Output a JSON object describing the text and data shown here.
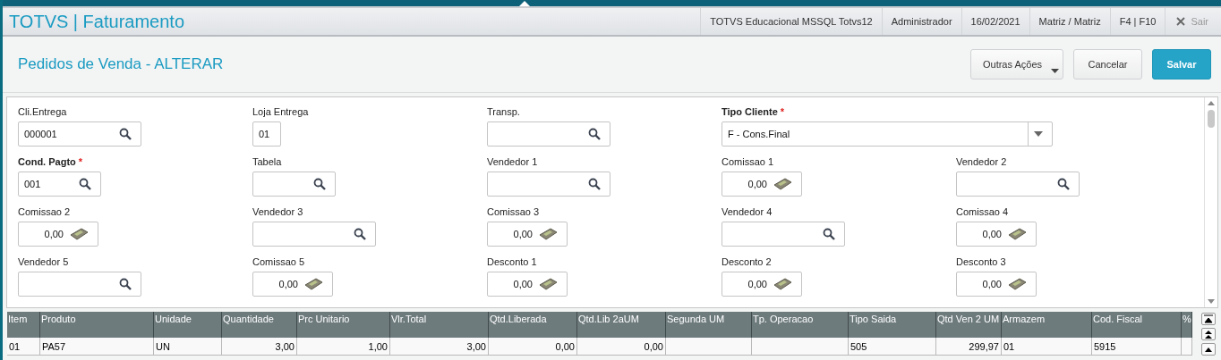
{
  "app_header": {
    "title": "TOTVS | Faturamento",
    "status_items": [
      "TOTVS Educacional MSSQL Totvs12",
      "Administrador",
      "16/02/2021",
      "Matriz / Matriz",
      "F4 | F10"
    ],
    "exit": {
      "label": "Sair",
      "disabled": true
    }
  },
  "page": {
    "title": "Pedidos de Venda - ALTERAR",
    "buttons": [
      {
        "label": "Outras Ações",
        "kind": "menu"
      },
      {
        "label": "Cancelar",
        "kind": "secondary"
      },
      {
        "label": "Salvar",
        "kind": "primary"
      }
    ]
  },
  "form": {
    "fields": [
      {
        "label": "Cli.Entrega",
        "kind": "lookup",
        "value": "000001"
      },
      {
        "label": "Loja Entrega",
        "kind": "plain",
        "value": "01"
      },
      {
        "label": "Transp.",
        "kind": "lookup"
      },
      {
        "label": "Tipo Cliente",
        "kind": "select",
        "value": "F - Cons.Final",
        "required_mark": "*"
      },
      {
        "label": "Cond. Pagto",
        "kind": "lookup_short",
        "value": "001",
        "required_mark": "*"
      },
      {
        "label": "Tabela",
        "kind": "lookup_short"
      },
      {
        "label": "Vendedor 1",
        "kind": "lookup"
      },
      {
        "label": "Comissao 1",
        "kind": "money",
        "value": "0,00"
      },
      {
        "label": "Vendedor 2",
        "kind": "lookup"
      },
      {
        "label": "Comissao 2",
        "kind": "money",
        "value": "0,00"
      },
      {
        "label": "Vendedor 3",
        "kind": "lookup"
      },
      {
        "label": "Comissao 3",
        "kind": "money",
        "value": "0,00"
      },
      {
        "label": "Vendedor 4",
        "kind": "lookup"
      },
      {
        "label": "Comissao 4",
        "kind": "money",
        "value": "0,00"
      },
      {
        "label": "Vendedor 5",
        "kind": "lookup"
      },
      {
        "label": "Comissao 5",
        "kind": "money",
        "value": "0,00"
      },
      {
        "label": "Desconto 1",
        "kind": "money",
        "value": "0,00"
      },
      {
        "label": "Desconto 2",
        "kind": "money",
        "value": "0,00"
      },
      {
        "label": "Desconto 3",
        "kind": "money",
        "value": "0,00"
      }
    ]
  },
  "table": {
    "columns": [
      {
        "label": "Item",
        "kind": "text"
      },
      {
        "label": "Produto",
        "kind": "text"
      },
      {
        "label": "Unidade",
        "kind": "text"
      },
      {
        "label": "Quantidade",
        "kind": "number"
      },
      {
        "label": "Prc Unitario",
        "kind": "number"
      },
      {
        "label": "Vlr.Total",
        "kind": "number"
      },
      {
        "label": "Qtd.Liberada",
        "kind": "number"
      },
      {
        "label": "Qtd.Lib 2aUM",
        "kind": "number"
      },
      {
        "label": "Segunda UM",
        "kind": "text"
      },
      {
        "label": "Tp. Operacao",
        "kind": "text"
      },
      {
        "label": "Tipo Saida",
        "kind": "text"
      },
      {
        "label": "Qtd Ven 2 UM",
        "kind": "number"
      },
      {
        "label": "Armazem",
        "kind": "text"
      },
      {
        "label": "Cod. Fiscal",
        "kind": "text"
      },
      {
        "label": "%",
        "kind": "text"
      }
    ],
    "rows": [
      [
        "01",
        "PA57",
        "UN",
        "3,00",
        "1,00",
        "3,00",
        "0,00",
        "0,00",
        null,
        null,
        "505",
        "299,97",
        "01",
        "5915",
        null
      ]
    ]
  }
}
